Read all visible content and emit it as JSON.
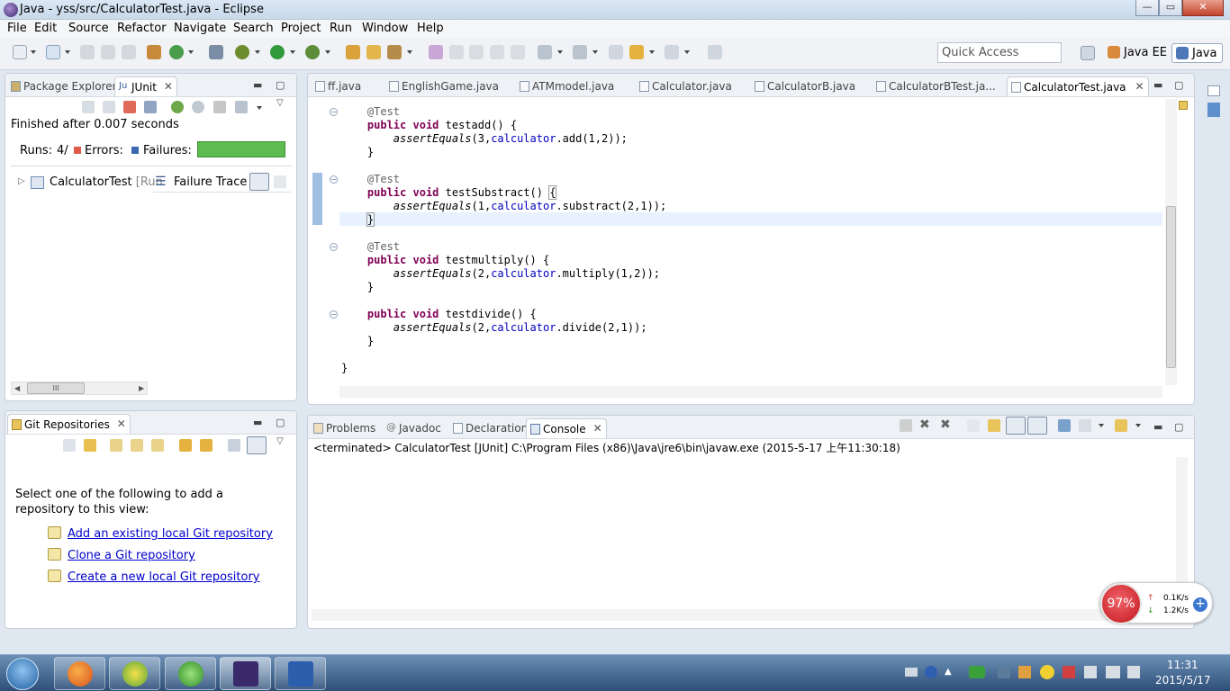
{
  "window": {
    "title": "Java - yss/src/CalculatorTest.java - Eclipse",
    "minimize": "—",
    "maximize": "▭",
    "close": "✕"
  },
  "menu": [
    "File",
    "Edit",
    "Source",
    "Refactor",
    "Navigate",
    "Search",
    "Project",
    "Run",
    "Window",
    "Help"
  ],
  "toolbar": {
    "quick_access_placeholder": "Quick Access",
    "perspectives": [
      "Java EE",
      "Java"
    ]
  },
  "left_top": {
    "tabs": [
      "Package Explorer",
      "JUnit"
    ],
    "status": "Finished after 0.007 seconds",
    "runs_label": "Runs:",
    "runs_value": "4/",
    "errors_label": "Errors:",
    "failures_label": "Failures:",
    "tree_item": "CalculatorTest",
    "tree_item_suffix": "[Run",
    "failure_trace": "Failure Trace",
    "scroll_thumb": "III"
  },
  "editor": {
    "tabs": [
      "ff.java",
      "EnglishGame.java",
      "ATMmodel.java",
      "Calculator.java",
      "CalculatorB.java",
      "CalculatorBTest.ja...",
      "CalculatorTest.java"
    ],
    "active_tab": "CalculatorTest.java"
  },
  "git": {
    "tab": "Git Repositories",
    "intro": "Select one of the following to add a repository to this view:",
    "links": [
      "Add an existing local Git repository",
      "Clone a Git repository",
      "Create a new local Git repository"
    ]
  },
  "console": {
    "tabs": [
      "Problems",
      "Javadoc",
      "Declaration",
      "Console"
    ],
    "active_tab": "Console",
    "text": "<terminated> CalculatorTest [JUnit] C:\\Program Files (x86)\\Java\\jre6\\bin\\javaw.exe (2015-5-17 上午11:30:18)"
  },
  "netwidget": {
    "percent": "97%",
    "up": "0.1K/s",
    "down": "1.2K/s"
  },
  "taskbar": {
    "time": "11:31",
    "date": "2015/5/17"
  },
  "colors": {
    "junit_bar": "#5dbb52",
    "keyword": "#7f0055",
    "field": "#0000c0",
    "link": "#0000cc"
  }
}
